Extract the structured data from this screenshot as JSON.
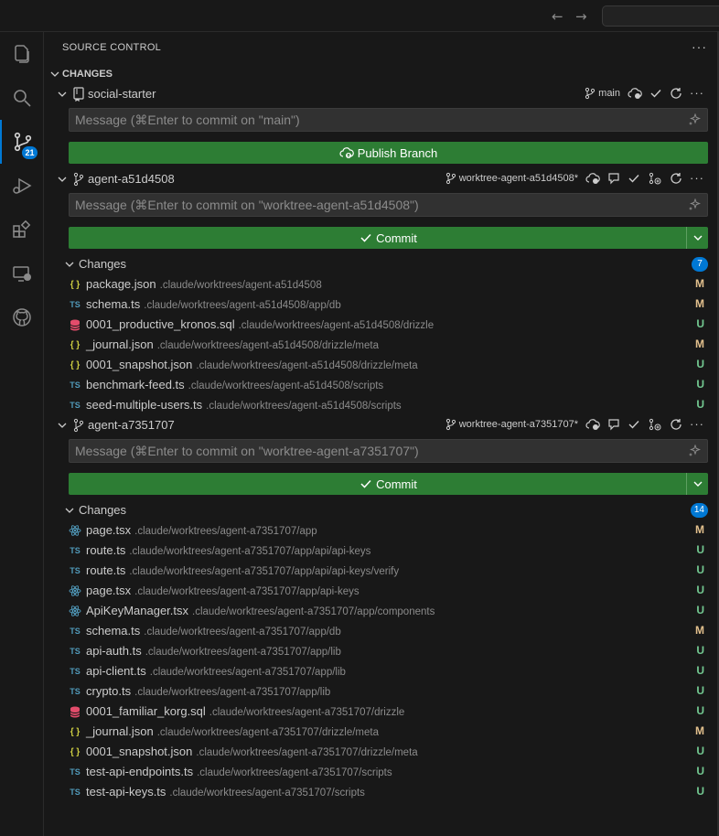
{
  "panel": {
    "title": "SOURCE CONTROL",
    "section": "CHANGES"
  },
  "activity": {
    "scm_badge": "21"
  },
  "colors": {
    "accent": "#0078d4",
    "button": "#2d7d34",
    "modified": "#e2c08d",
    "untracked": "#73c991"
  },
  "repos": [
    {
      "name": "social-starter",
      "branch": "main",
      "placeholder": "Message (⌘Enter to commit on \"main\")",
      "button": "Publish Branch"
    },
    {
      "name": "agent-a51d4508",
      "branch": "worktree-agent-a51d4508*",
      "placeholder": "Message (⌘Enter to commit on \"worktree-agent-a51d4508\")",
      "button": "Commit",
      "group_label": "Changes",
      "count": "7",
      "files": [
        {
          "icon": "json",
          "name": "package.json",
          "path": ".claude/worktrees/agent-a51d4508",
          "status": "M"
        },
        {
          "icon": "ts",
          "name": "schema.ts",
          "path": ".claude/worktrees/agent-a51d4508/app/db",
          "status": "M"
        },
        {
          "icon": "sql",
          "name": "0001_productive_kronos.sql",
          "path": ".claude/worktrees/agent-a51d4508/drizzle",
          "status": "U"
        },
        {
          "icon": "json",
          "name": "_journal.json",
          "path": ".claude/worktrees/agent-a51d4508/drizzle/meta",
          "status": "M"
        },
        {
          "icon": "json",
          "name": "0001_snapshot.json",
          "path": ".claude/worktrees/agent-a51d4508/drizzle/meta",
          "status": "U"
        },
        {
          "icon": "ts",
          "name": "benchmark-feed.ts",
          "path": ".claude/worktrees/agent-a51d4508/scripts",
          "status": "U"
        },
        {
          "icon": "ts",
          "name": "seed-multiple-users.ts",
          "path": ".claude/worktrees/agent-a51d4508/scripts",
          "status": "U"
        }
      ]
    },
    {
      "name": "agent-a7351707",
      "branch": "worktree-agent-a7351707*",
      "placeholder": "Message (⌘Enter to commit on \"worktree-agent-a7351707\")",
      "button": "Commit",
      "group_label": "Changes",
      "count": "14",
      "files": [
        {
          "icon": "tsx",
          "name": "page.tsx",
          "path": ".claude/worktrees/agent-a7351707/app",
          "status": "M"
        },
        {
          "icon": "ts",
          "name": "route.ts",
          "path": ".claude/worktrees/agent-a7351707/app/api/api-keys",
          "status": "U"
        },
        {
          "icon": "ts",
          "name": "route.ts",
          "path": ".claude/worktrees/agent-a7351707/app/api/api-keys/verify",
          "status": "U"
        },
        {
          "icon": "tsx",
          "name": "page.tsx",
          "path": ".claude/worktrees/agent-a7351707/app/api-keys",
          "status": "U"
        },
        {
          "icon": "tsx",
          "name": "ApiKeyManager.tsx",
          "path": ".claude/worktrees/agent-a7351707/app/components",
          "status": "U"
        },
        {
          "icon": "ts",
          "name": "schema.ts",
          "path": ".claude/worktrees/agent-a7351707/app/db",
          "status": "M"
        },
        {
          "icon": "ts",
          "name": "api-auth.ts",
          "path": ".claude/worktrees/agent-a7351707/app/lib",
          "status": "U"
        },
        {
          "icon": "ts",
          "name": "api-client.ts",
          "path": ".claude/worktrees/agent-a7351707/app/lib",
          "status": "U"
        },
        {
          "icon": "ts",
          "name": "crypto.ts",
          "path": ".claude/worktrees/agent-a7351707/app/lib",
          "status": "U"
        },
        {
          "icon": "sql",
          "name": "0001_familiar_korg.sql",
          "path": ".claude/worktrees/agent-a7351707/drizzle",
          "status": "U"
        },
        {
          "icon": "json",
          "name": "_journal.json",
          "path": ".claude/worktrees/agent-a7351707/drizzle/meta",
          "status": "M"
        },
        {
          "icon": "json",
          "name": "0001_snapshot.json",
          "path": ".claude/worktrees/agent-a7351707/drizzle/meta",
          "status": "U"
        },
        {
          "icon": "ts",
          "name": "test-api-endpoints.ts",
          "path": ".claude/worktrees/agent-a7351707/scripts",
          "status": "U"
        },
        {
          "icon": "ts",
          "name": "test-api-keys.ts",
          "path": ".claude/worktrees/agent-a7351707/scripts",
          "status": "U"
        }
      ]
    }
  ]
}
